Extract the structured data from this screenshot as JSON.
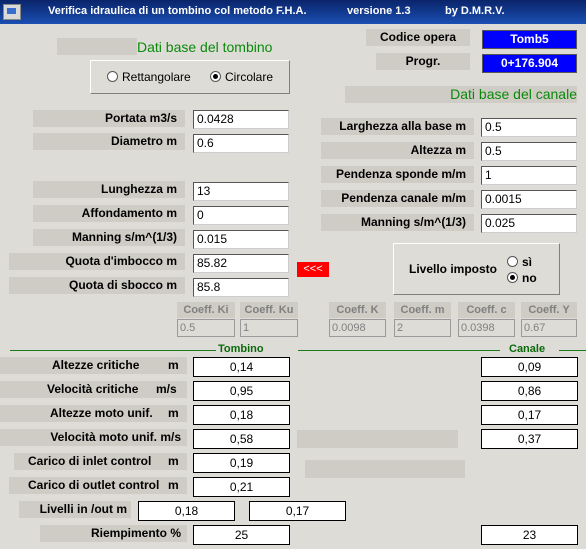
{
  "window": {
    "title": "Verifica idraulica di un tombino col metodo F.H.A.",
    "version": "versione 1.3",
    "author": "by D.M.R.V."
  },
  "header": {
    "dati_tombino": "Dati base del tombino",
    "dati_canale": "Dati base del canale",
    "codice_label": "Codice opera",
    "codice_value": "Tomb5",
    "progr_label": "Progr.",
    "progr_value": "0+176.904"
  },
  "shape": {
    "option1": "Rettangolare",
    "option2": "Circolare",
    "selected": "Circolare"
  },
  "tombino_inputs": {
    "portata": {
      "label": "Portata m3/s",
      "value": "0.0428"
    },
    "diametro": {
      "label": "Diametro m",
      "value": "0.6"
    },
    "lunghezza": {
      "label": "Lunghezza m",
      "value": "13"
    },
    "affondamento": {
      "label": "Affondamento m",
      "value": "0"
    },
    "manning": {
      "label": "Manning s/m^(1/3)",
      "value": "0.015"
    },
    "quota_imbocco": {
      "label": "Quota d'imbocco m",
      "value": "85.82"
    },
    "quota_sbocco": {
      "label": "Quota di sbocco m",
      "value": "85.8"
    }
  },
  "canale_inputs": {
    "larghezza": {
      "label": "Larghezza alla base m",
      "value": "0.5"
    },
    "altezza": {
      "label": "Altezza m",
      "value": "0.5"
    },
    "pendenza_sponde": {
      "label": "Pendenza sponde m/m",
      "value": "1"
    },
    "pendenza_canale": {
      "label": "Pendenza canale m/m",
      "value": "0.0015"
    },
    "manning": {
      "label": "Manning s/m^(1/3)",
      "value": "0.025"
    }
  },
  "copy_button": "<<<",
  "livello": {
    "label": "Livello imposto",
    "yes": "sì",
    "no": "no",
    "selected": "no"
  },
  "coefficients": [
    {
      "label": "Coeff. Ki",
      "value": "0.5"
    },
    {
      "label": "Coeff. Ku",
      "value": "1"
    },
    {
      "label": "Coeff. K",
      "value": "0.0098"
    },
    {
      "label": "Coeff. m",
      "value": "2"
    },
    {
      "label": "Coeff. c",
      "value": "0.0398"
    },
    {
      "label": "Coeff. Y",
      "value": "0.67"
    }
  ],
  "results": {
    "tombino_header": "Tombino",
    "canale_header": "Canale",
    "altezze_critiche": {
      "label": "Altezze critiche",
      "unit": "m",
      "tombino": "0,14",
      "canale": "0,09"
    },
    "velocita_critiche": {
      "label": "Velocità critiche",
      "unit": "m/s",
      "tombino": "0,95",
      "canale": "0,86"
    },
    "altezze_moto": {
      "label": "Altezze moto unif.",
      "unit": "m",
      "tombino": "0,18",
      "canale": "0,17"
    },
    "velocita_moto": {
      "label": "Velocità moto unif. m/s",
      "tombino": "0,58",
      "canale": "0,37"
    },
    "carico_inlet": {
      "label": "Carico di inlet control",
      "unit": "m",
      "tombino": "0,19"
    },
    "carico_outlet": {
      "label": "Carico di outlet control",
      "unit": "m",
      "tombino": "0,21"
    },
    "livelli": {
      "label": "Livelli  in /out m",
      "in": "0,18",
      "out": "0,17"
    },
    "riempimento": {
      "label": "Riempimento %",
      "tombino": "25",
      "canale": "23"
    }
  }
}
